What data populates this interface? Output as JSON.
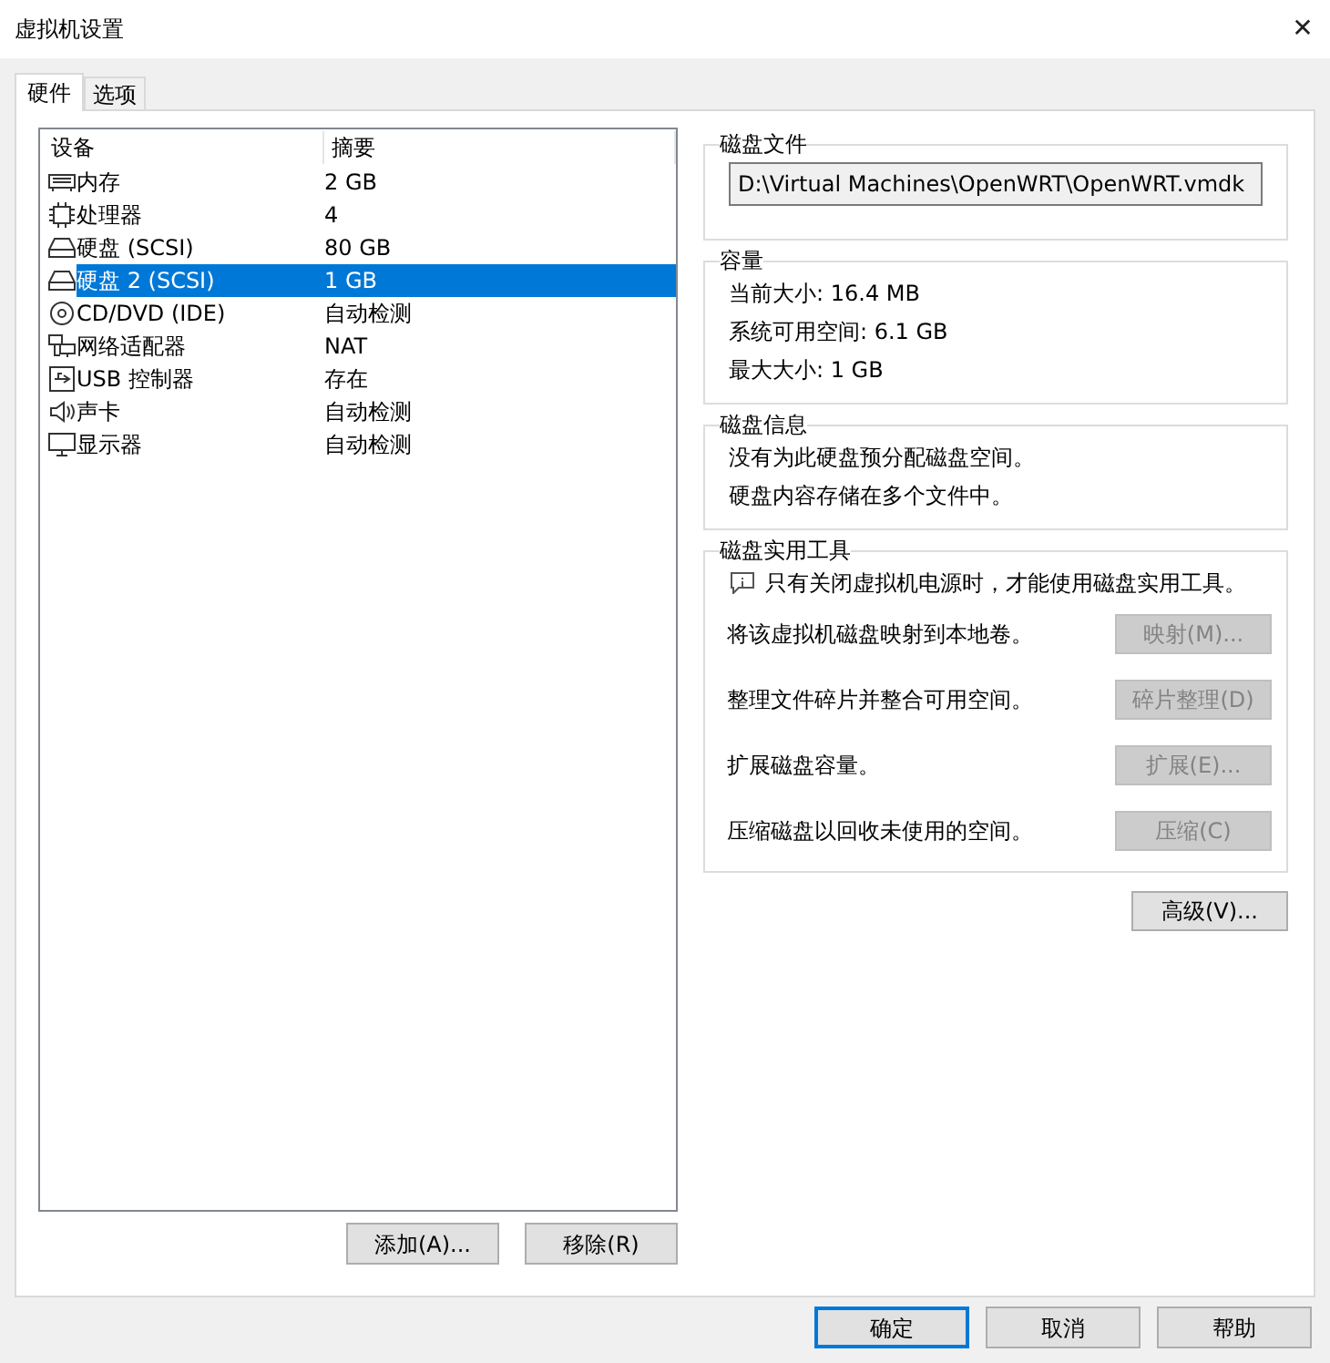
{
  "window": {
    "title": "虚拟机设置",
    "close": "✕"
  },
  "tabs": [
    {
      "label": "硬件",
      "selected": true
    },
    {
      "label": "选项",
      "selected": false
    }
  ],
  "device_table": {
    "columns": [
      "设备",
      "摘要"
    ],
    "rows": [
      {
        "kind": "memory",
        "device": "内存",
        "summary": "2 GB",
        "selected": false
      },
      {
        "kind": "cpu",
        "device": "处理器",
        "summary": "4",
        "selected": false
      },
      {
        "kind": "disk",
        "device": "硬盘 (SCSI)",
        "summary": "80 GB",
        "selected": false
      },
      {
        "kind": "disk",
        "device": "硬盘 2 (SCSI)",
        "summary": "1 GB",
        "selected": true
      },
      {
        "kind": "cdrom",
        "device": "CD/DVD (IDE)",
        "summary": "自动检测",
        "selected": false
      },
      {
        "kind": "network",
        "device": "网络适配器",
        "summary": "NAT",
        "selected": false
      },
      {
        "kind": "usb",
        "device": "USB 控制器",
        "summary": "存在",
        "selected": false
      },
      {
        "kind": "sound",
        "device": "声卡",
        "summary": "自动检测",
        "selected": false
      },
      {
        "kind": "display",
        "device": "显示器",
        "summary": "自动检测",
        "selected": false
      }
    ]
  },
  "device_buttons": [
    "添加(A)...",
    "移除(R)"
  ],
  "disk_file": {
    "title": "磁盘文件",
    "value": "D:\\Virtual Machines\\OpenWRT\\OpenWRT.vmdk"
  },
  "capacity": {
    "title": "容量",
    "lines": [
      "当前大小: 16.4 MB",
      "系统可用空间: 6.1 GB",
      "最大大小: 1 GB"
    ]
  },
  "disk_info": {
    "title": "磁盘信息",
    "lines": [
      "没有为此硬盘预分配磁盘空间。",
      "硬盘内容存储在多个文件中。"
    ]
  },
  "disk_utilities": {
    "title": "磁盘实用工具",
    "notice": "只有关闭虚拟机电源时，才能使用磁盘实用工具。",
    "rows": [
      {
        "label": "将该虚拟机磁盘映射到本地卷。",
        "button": "映射(M)...",
        "disabled": true
      },
      {
        "label": "整理文件碎片并整合可用空间。",
        "button": "碎片整理(D)",
        "disabled": true
      },
      {
        "label": "扩展磁盘容量。",
        "button": "扩展(E)...",
        "disabled": true
      },
      {
        "label": "压缩磁盘以回收未使用的空间。",
        "button": "压缩(C)",
        "disabled": true
      }
    ]
  },
  "advanced_button": "高级(V)...",
  "footer_buttons": [
    {
      "label": "确定",
      "default": true
    },
    {
      "label": "取消",
      "default": false
    },
    {
      "label": "帮助",
      "default": false
    }
  ]
}
